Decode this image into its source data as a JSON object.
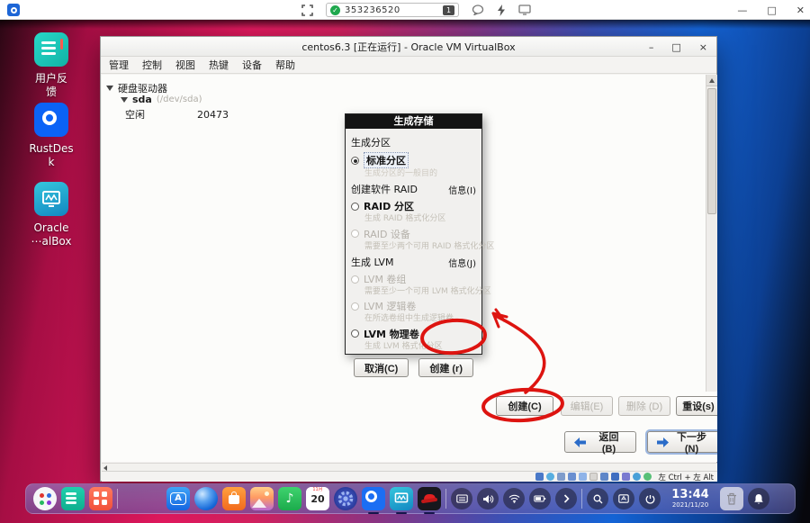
{
  "remote_bar": {
    "session_id": "353236520",
    "monitor_badge": "1",
    "controls": {
      "minimize": "—",
      "maximize": "□",
      "close": "✕"
    }
  },
  "desktop_icons": [
    {
      "label": "用户反\n馈"
    },
    {
      "label": "RustDes\nk"
    },
    {
      "label": "Oracle\n⋯alBox"
    }
  ],
  "vbox": {
    "title": "centos6.3 [正在运行] - Oracle VM VirtualBox",
    "controls": {
      "minimize": "–",
      "maximize": "□",
      "close": "×"
    },
    "menus": [
      "管理",
      "控制",
      "视图",
      "热键",
      "设备",
      "帮助"
    ],
    "tree": {
      "root": "硬盘驱动器",
      "disk": "sda",
      "disk_path": "(/dev/sda)",
      "free_label": "空闲",
      "free_size": "20473"
    },
    "dialog": {
      "title": "生成存储",
      "section_partition": "生成分区",
      "radio_standard": {
        "label": "标准分区",
        "desc": "生成分区的一般目的"
      },
      "section_raid": {
        "header": "创建软件 RAID",
        "info": "信息(I)"
      },
      "radio_raid_partition": {
        "label": "RAID 分区",
        "desc": "生成 RAID 格式化分区"
      },
      "radio_raid_device": {
        "label": "RAID 设备",
        "desc": "需要至少两个可用 RAID 格式化分区"
      },
      "section_lvm": {
        "header": "生成 LVM",
        "info": "信息(J)"
      },
      "radio_lvm_vg": {
        "label": "LVM 卷组",
        "desc": "需要至少一个可用 LVM 格式化分区"
      },
      "radio_lvm_lv": {
        "label": "LVM 逻辑卷",
        "desc": "在所选卷组中生成逻辑卷"
      },
      "radio_lvm_pv": {
        "label": "LVM 物理卷",
        "desc": "生成 LVM 格式化分区"
      },
      "cancel_label": "取消(C)",
      "create_label": "创建 (r)"
    },
    "actions": {
      "create": "创建(C)",
      "edit": "编辑(E)",
      "delete": "删除 (D)",
      "reset": "重设(s)"
    },
    "nav": {
      "back": "返回 (B)",
      "next": "下一步 (N)"
    },
    "statusbar": {
      "hostkey": "左 Ctrl + 左 Alt"
    }
  },
  "dock": {
    "appstore_letter": "A",
    "music_glyph": "♪",
    "calendar_month": "11月",
    "calendar_day": "20",
    "clock_time": "13:44",
    "clock_date": "2021/11/20"
  },
  "colors": {
    "annotation_red": "#dd1410",
    "nav_arrow_blue": "#2a6bc8",
    "shield_green": "#1fa84d"
  }
}
